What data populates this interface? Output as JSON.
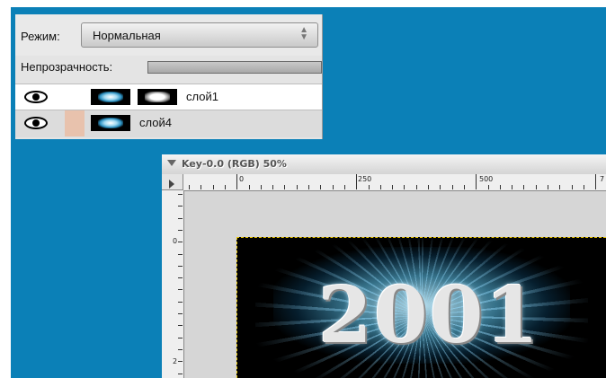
{
  "layers_panel": {
    "mode_label": "Режим:",
    "mode_value": "Нормальная",
    "opacity_label": "Непрозрачность:",
    "opacity_fraction": 0.0,
    "layers": [
      {
        "name": "слой1",
        "visible": true,
        "has_mask": true,
        "selected": false
      },
      {
        "name": "слой4",
        "visible": true,
        "has_mask": false,
        "selected": true
      }
    ]
  },
  "image_window": {
    "title": "Key-0.0 (RGB) 50%",
    "ruler_h_labels": [
      "0",
      "250",
      "500",
      "7"
    ],
    "ruler_v_labels": [
      "0",
      "2"
    ],
    "image_text": "2001"
  },
  "colors": {
    "desktop": "#0b80b7",
    "selection_marquee": "#e8c400",
    "link_cell": "#e8c2ad"
  },
  "icons": {
    "visibility": "eye-icon",
    "window_menu": "triangle-down-icon",
    "ruler_origin": "triangle-right-icon"
  }
}
